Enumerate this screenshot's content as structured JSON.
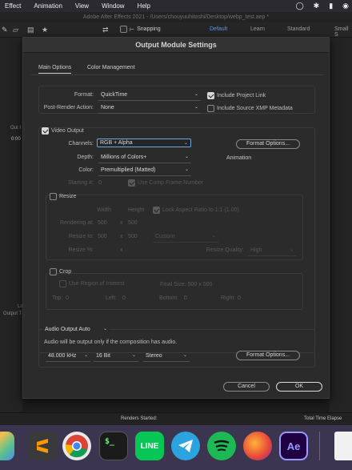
{
  "menubar": {
    "items": [
      "Effect",
      "Animation",
      "View",
      "Window",
      "Help"
    ]
  },
  "window_title": "Adobe After Effects 2021 - /Users/chouyuuhitoshi/Desktop/webp_test.aep *",
  "toolbar": {
    "snapping_label": "Snapping",
    "workspaces": [
      "Default",
      "Learn",
      "Standard",
      "Small S"
    ]
  },
  "background": {
    "out_label": "Out I",
    "time_value": "0:00",
    "lo_label": "Lo",
    "output_label": "Output T",
    "renders_started": "Renders Started:",
    "total_time": "Total Time Elapse"
  },
  "dialog": {
    "title": "Output Module Settings",
    "tabs": [
      "Main Options",
      "Color Management"
    ],
    "format": {
      "label": "Format:",
      "value": "QuickTime"
    },
    "post_render": {
      "label": "Post-Render Action:",
      "value": "None"
    },
    "include_project_link": {
      "label": "Include Project Link",
      "checked": true
    },
    "include_xmp": {
      "label": "Include Source XMP Metadata",
      "checked": false
    },
    "video_output": {
      "label": "Video Output",
      "checked": true,
      "channels": {
        "label": "Channels:",
        "value": "RGB + Alpha"
      },
      "depth": {
        "label": "Depth:",
        "value": "Millions of Colors+"
      },
      "color": {
        "label": "Color:",
        "value": "Premultiplied (Matted)"
      },
      "starting": {
        "label": "Starting #:",
        "value": "0"
      },
      "use_comp_frame": {
        "label": "Use Comp Frame Number",
        "checked": true
      },
      "format_options": "Format Options...",
      "codec": "Animation"
    },
    "resize": {
      "label": "Resize",
      "checked": false,
      "col_width": "Width",
      "col_height": "Height",
      "lock_aspect": "Lock Aspect Ratio to 1:1 (1.00)",
      "rendering_at": {
        "label": "Rendering at:",
        "w": "500",
        "x": "x",
        "h": "500"
      },
      "resize_to": {
        "label": "Resize to:",
        "w": "500",
        "x": "x",
        "h": "500",
        "preset": "Custom"
      },
      "resize_pct": {
        "label": "Resize %:",
        "x": "x"
      },
      "quality": {
        "label": "Resize Quality:",
        "value": "High"
      }
    },
    "crop": {
      "label": "Crop",
      "checked": false,
      "use_roi": "Use Region of Interest",
      "final_size": "Final Size: 500 x 500",
      "top": {
        "label": "Top:",
        "value": "0"
      },
      "left": {
        "label": "Left:",
        "value": "0"
      },
      "bottom": {
        "label": "Bottom:",
        "value": "0"
      },
      "right": {
        "label": "Right:",
        "value": "0"
      }
    },
    "audio": {
      "mode": "Audio Output Auto",
      "note": "Audio will be output only if the composition has audio.",
      "rate": "48.000 kHz",
      "bits": "16 Bit",
      "channels": "Stereo",
      "format_options": "Format Options..."
    },
    "cancel_label": "Cancel",
    "ok_label": "OK"
  },
  "dock": {
    "apps": [
      "Launchpad",
      "Sublime Text",
      "Chrome",
      "Terminal",
      "LINE",
      "Telegram",
      "Spotify",
      "Firefox",
      "After Effects",
      "Document"
    ],
    "line_label": "LINE",
    "ae_label": "Ae",
    "terminal_label": "$_"
  },
  "colors": {
    "accent": "#4f9bff",
    "dialog_bg": "#2b2b2b",
    "dock_bg": "#3b3550"
  }
}
